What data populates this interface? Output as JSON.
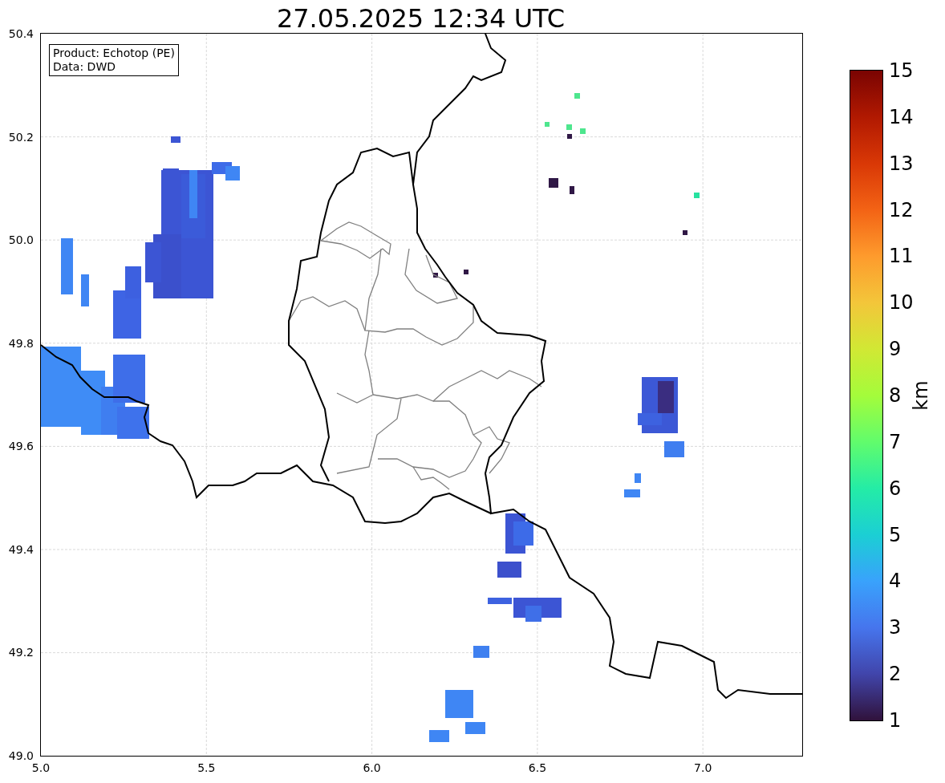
{
  "title": "27.05.2025 12:34 UTC",
  "info_box": [
    "Product: Echotop (PE)",
    "Data: DWD"
  ],
  "x_ticks": [
    "5.0",
    "5.5",
    "6.0",
    "6.5",
    "7.0"
  ],
  "y_ticks": [
    "50.4",
    "50.2",
    "50.0",
    "49.8",
    "49.6",
    "49.4",
    "49.2",
    "49.0"
  ],
  "colorbar": {
    "label": "km",
    "ticks": [
      "15",
      "14",
      "13",
      "12",
      "11",
      "10",
      "9",
      "8",
      "7",
      "6",
      "5",
      "4",
      "3",
      "2",
      "1"
    ]
  }
}
